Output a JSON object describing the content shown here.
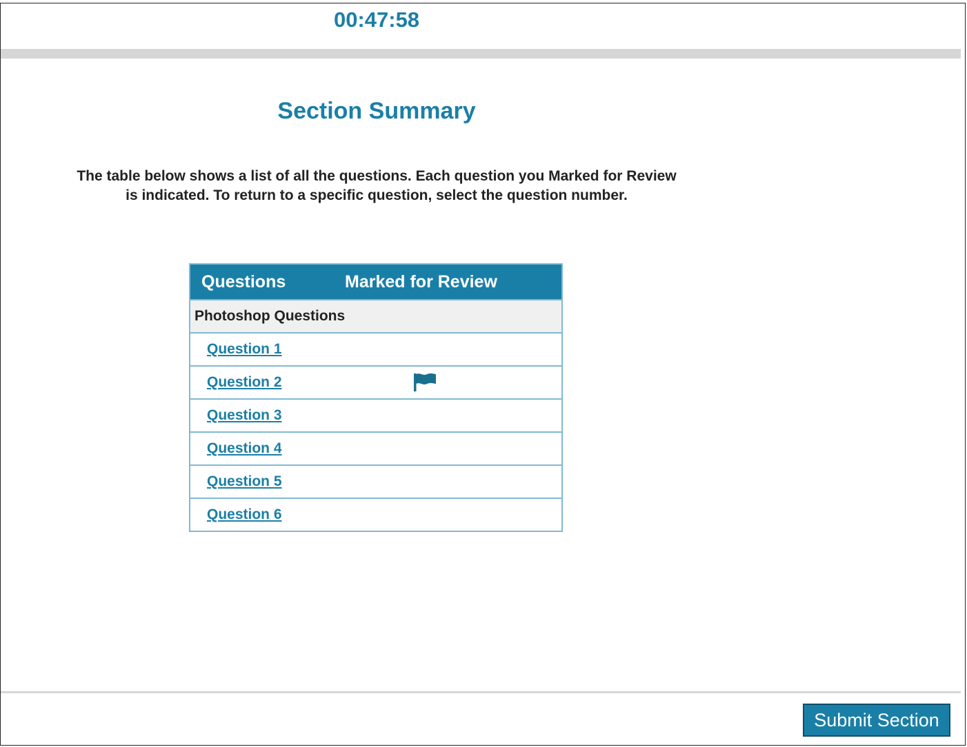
{
  "timer": {
    "value": "00:47:58"
  },
  "page": {
    "title": "Section Summary",
    "instructions": "The table below shows a list of all the questions. Each question you Marked for Review is indicated. To return to a specific question, select the question number."
  },
  "table": {
    "headers": {
      "questions": "Questions",
      "marked": "Marked for Review"
    },
    "group_label": "Photoshop Questions",
    "rows": [
      {
        "label": "Question 1",
        "marked": false
      },
      {
        "label": "Question 2",
        "marked": true
      },
      {
        "label": "Question 3",
        "marked": false
      },
      {
        "label": "Question 4",
        "marked": false
      },
      {
        "label": "Question 5",
        "marked": false
      },
      {
        "label": "Question 6",
        "marked": false
      }
    ],
    "flag_icon": "flag-icon"
  },
  "footer": {
    "submit_label": "Submit Section"
  },
  "colors": {
    "accent": "#1a7fa7",
    "table_border": "#80b9d2",
    "flag": "#1a6f8f"
  }
}
